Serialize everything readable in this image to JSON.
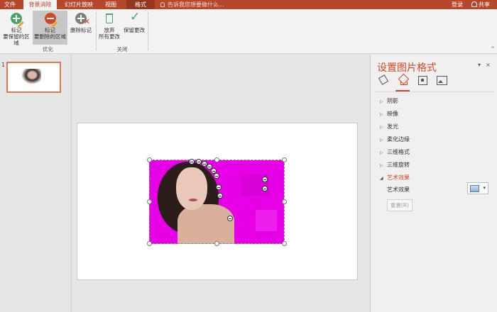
{
  "tabs": [
    "文件",
    "背景消除",
    "幻灯片放映",
    "视图",
    "格式"
  ],
  "tell_me": "告诉我您想要做什么...",
  "account": {
    "login": "登录",
    "share": "共享"
  },
  "ribbon": {
    "mark_keep": [
      "标记",
      "要保留的区域"
    ],
    "mark_remove": [
      "标记",
      "要删除的区域"
    ],
    "delete_mark": "删除标记",
    "discard": [
      "放弃",
      "所有更改"
    ],
    "keep_changes": "保留更改",
    "group_optimize": "优化",
    "group_close": "关闭",
    "collapse": "^"
  },
  "slides": {
    "number": "1"
  },
  "format_pane": {
    "title": "设置图片格式",
    "dropdown": "▾",
    "close": "×",
    "sections": [
      {
        "label": "阴影",
        "arrow": "▷"
      },
      {
        "label": "映像",
        "arrow": "▷"
      },
      {
        "label": "发光",
        "arrow": "▷"
      },
      {
        "label": "柔化边缘",
        "arrow": "▷"
      },
      {
        "label": "三维格式",
        "arrow": "▷"
      },
      {
        "label": "三维旋转",
        "arrow": "▷"
      },
      {
        "label": "艺术效果",
        "arrow": "◢"
      }
    ],
    "artistic_label": "艺术效果",
    "artistic_caret": "▾",
    "reset": "重置(R)"
  },
  "colors": {
    "accent": "#b7472a",
    "selected_text": "#d24726",
    "removed_bg": "#e600e6"
  }
}
